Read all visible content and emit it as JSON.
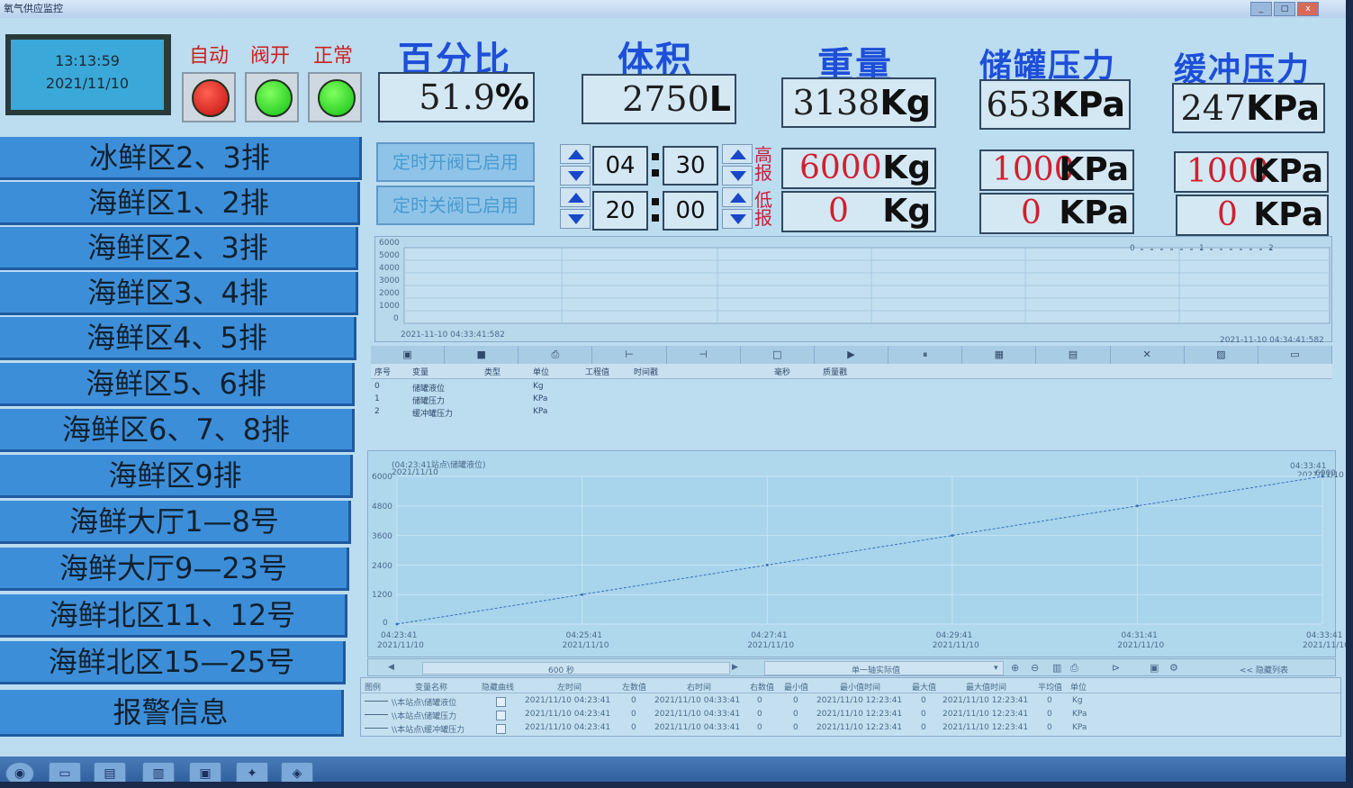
{
  "window": {
    "title": "氧气供应监控"
  },
  "clock": {
    "time": "13:13:59",
    "date": "2021/11/10"
  },
  "lamps": [
    {
      "label": "自动",
      "state": "red"
    },
    {
      "label": "阀开",
      "state": "green"
    },
    {
      "label": "正常",
      "state": "green"
    }
  ],
  "metrics": [
    {
      "title": "百分比",
      "value": "51.9",
      "unit": "%"
    },
    {
      "title": "体积",
      "value": "2750",
      "unit": "L"
    },
    {
      "title": "重量",
      "value": "3138",
      "unit": "Kg"
    },
    {
      "title": "储罐压力",
      "value": "653",
      "unit": "KPa"
    },
    {
      "title": "缓冲压力",
      "value": "247",
      "unit": "KPa"
    }
  ],
  "nav": [
    "冰鲜区2、3排",
    "海鲜区1、2排",
    "海鲜区2、3排",
    "海鲜区3、4排",
    "海鲜区4、5排",
    "海鲜区5、6排",
    "海鲜区6、7、8排",
    "海鲜区9排",
    "海鲜大厅1—8号",
    "海鲜大厅9—23号",
    "海鲜北区11、12号",
    "海鲜北区15—25号",
    "报警信息"
  ],
  "timer": {
    "open_label": "定时开阀已启用",
    "close_label": "定时关阀已启用",
    "open_hh": "04",
    "open_mm": "30",
    "close_hh": "20",
    "close_mm": "00"
  },
  "alarm": {
    "high_label": "高报",
    "low_label": "低报",
    "weight_high": "6000",
    "weight_high_unit": "Kg",
    "weight_low": "0",
    "weight_low_unit": "Kg",
    "tank_high": "1000",
    "tank_high_unit": "KPa",
    "tank_low": "0",
    "tank_low_unit": "KPa",
    "buffer_high": "1000",
    "buffer_high_unit": "KPa",
    "buffer_low": "0",
    "buffer_low_unit": "KPa"
  },
  "trend_top": {
    "yticks": [
      "6000",
      "5000",
      "4000",
      "3000",
      "2000",
      "1000",
      "0"
    ],
    "start": "2021-11-10 04:33:41:582",
    "end": "2021-11-10 04:34:41:582",
    "legend_marks": [
      "0",
      "1",
      "2"
    ]
  },
  "var_table": {
    "headers": [
      "序号",
      "变量",
      "类型",
      "单位",
      "工程值",
      "时间戳",
      "毫秒",
      "质量戳"
    ],
    "rows": [
      {
        "idx": "0",
        "name": "储罐液位",
        "unit": "Kg"
      },
      {
        "idx": "1",
        "name": "储罐压力",
        "unit": "KPa"
      },
      {
        "idx": "2",
        "name": "缓冲罐压力",
        "unit": "KPa"
      }
    ]
  },
  "trend_main": {
    "header": "(04:23:41站点\\储罐液位)",
    "header_date": "2021/11/10",
    "right_time": "04:33:41",
    "right_date": "2021/11/10",
    "right_value": "6000",
    "yticks": [
      "6000",
      "4800",
      "3600",
      "2400",
      "1200",
      "0"
    ],
    "xticks": [
      {
        "t": "04:23:41",
        "d": "2021/11/10"
      },
      {
        "t": "04:25:41",
        "d": "2021/11/10"
      },
      {
        "t": "04:27:41",
        "d": "2021/11/10"
      },
      {
        "t": "04:29:41",
        "d": "2021/11/10"
      },
      {
        "t": "04:31:41",
        "d": "2021/11/10"
      },
      {
        "t": "04:33:41",
        "d": "2021/11/10"
      }
    ],
    "span": "600 秒",
    "mode": "单一轴实际值",
    "hide_list": "<< 隐藏列表"
  },
  "chart_data": {
    "type": "line",
    "title": "",
    "xlabel": "",
    "ylabel": "",
    "x": [
      "04:23:41",
      "04:25:41",
      "04:27:41",
      "04:29:41",
      "04:31:41",
      "04:33:41"
    ],
    "series": [
      {
        "values": [
          0,
          1200,
          2400,
          3600,
          4800,
          6000
        ]
      }
    ],
    "ylim": [
      0,
      6000
    ],
    "grid": true
  },
  "legend_table": {
    "headers": [
      "图例",
      "变量名称",
      "隐藏曲线",
      "左时间",
      "左数值",
      "右时间",
      "右数值",
      "最小值",
      "最小值时间",
      "最大值",
      "最大值时间",
      "平均值",
      "单位"
    ],
    "rows": [
      {
        "name": "\\\\本站点\\储罐液位",
        "lt": "2021/11/10 04:23:41",
        "lv": "0",
        "rt": "2021/11/10 04:33:41",
        "rv": "0",
        "min": "0",
        "mint": "2021/11/10 12:23:41",
        "max": "0",
        "maxt": "2021/11/10 12:23:41",
        "avg": "0",
        "unit": "Kg"
      },
      {
        "name": "\\\\本站点\\储罐压力",
        "lt": "2021/11/10 04:23:41",
        "lv": "0",
        "rt": "2021/11/10 04:33:41",
        "rv": "0",
        "min": "0",
        "mint": "2021/11/10 12:23:41",
        "max": "0",
        "maxt": "2021/11/10 12:23:41",
        "avg": "0",
        "unit": "KPa"
      },
      {
        "name": "\\\\本站点\\缓冲罐压力",
        "lt": "2021/11/10 04:23:41",
        "lv": "0",
        "rt": "2021/11/10 04:33:41",
        "rv": "0",
        "min": "0",
        "mint": "2021/11/10 12:23:41",
        "max": "0",
        "maxt": "2021/11/10 12:23:41",
        "avg": "0",
        "unit": "KPa"
      }
    ]
  },
  "colors": {
    "accent": "#1d4fd8",
    "alarm": "#d02030",
    "nav": "#3d8ed8"
  }
}
